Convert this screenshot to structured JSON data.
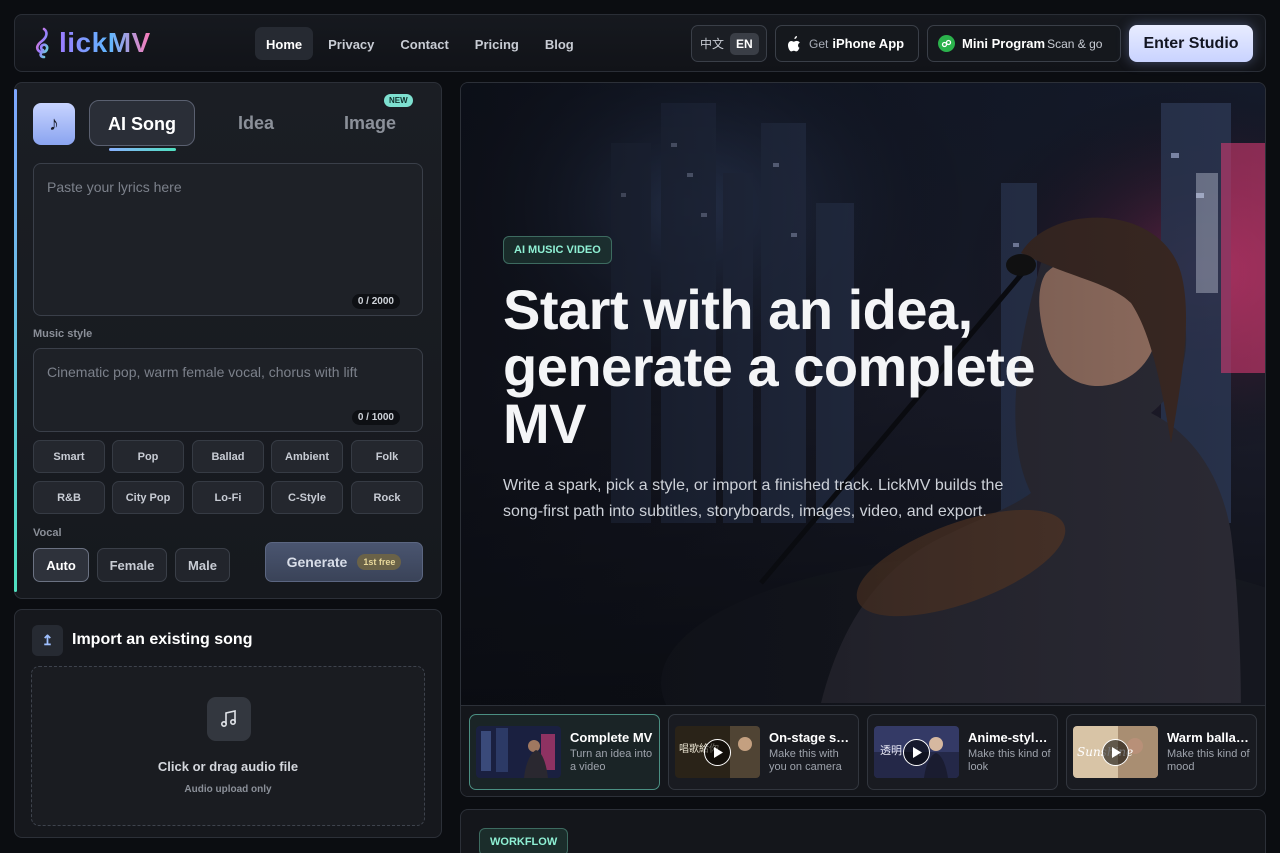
{
  "nav": {
    "brand": "lickMV",
    "links": [
      "Home",
      "Privacy",
      "Contact",
      "Pricing",
      "Blog"
    ],
    "lang_zh": "中文",
    "lang_en": "EN",
    "iphone_pre": "Get",
    "iphone_label": "iPhone App",
    "mini_label": "Mini Program",
    "mini_sub": "Scan & go",
    "studio": "Enter Studio"
  },
  "composer": {
    "tabs": [
      "AI Song",
      "Idea",
      "Image"
    ],
    "new_badge": "NEW",
    "lyrics_placeholder": "Paste your lyrics here",
    "lyrics_counter": "0 / 2000",
    "style_label": "Music style",
    "style_placeholder": "Cinematic pop, warm female vocal, chorus with lift",
    "style_counter": "0 / 1000",
    "chips": [
      "Smart",
      "Pop",
      "Ballad",
      "Ambient",
      "Folk",
      "R&B",
      "City Pop",
      "Lo-Fi",
      "C-Style",
      "Rock"
    ],
    "vocal_label": "Vocal",
    "vocals": [
      "Auto",
      "Female",
      "Male"
    ],
    "generate": "Generate",
    "free_badge": "1st free"
  },
  "import": {
    "title": "Import an existing song",
    "drop_title": "Click or drag audio file",
    "drop_sub": "Audio upload only"
  },
  "hero": {
    "badge": "AI MUSIC VIDEO",
    "title": "Start with an idea, generate a complete MV",
    "description": "Write a spark, pick a style, or import a finished track. LickMV builds the song-first path into subtitles, storyboards, images, video, and export."
  },
  "cards": [
    {
      "title": "Complete MV",
      "sub": "Turn an idea into a video"
    },
    {
      "title": "On-stage s…",
      "sub": "Make this with you on camera"
    },
    {
      "title": "Anime-styl…",
      "sub": "Make this kind of look"
    },
    {
      "title": "Warm balla…",
      "sub": "Make this kind of mood"
    }
  ],
  "workflow": {
    "badge": "WORKFLOW"
  }
}
